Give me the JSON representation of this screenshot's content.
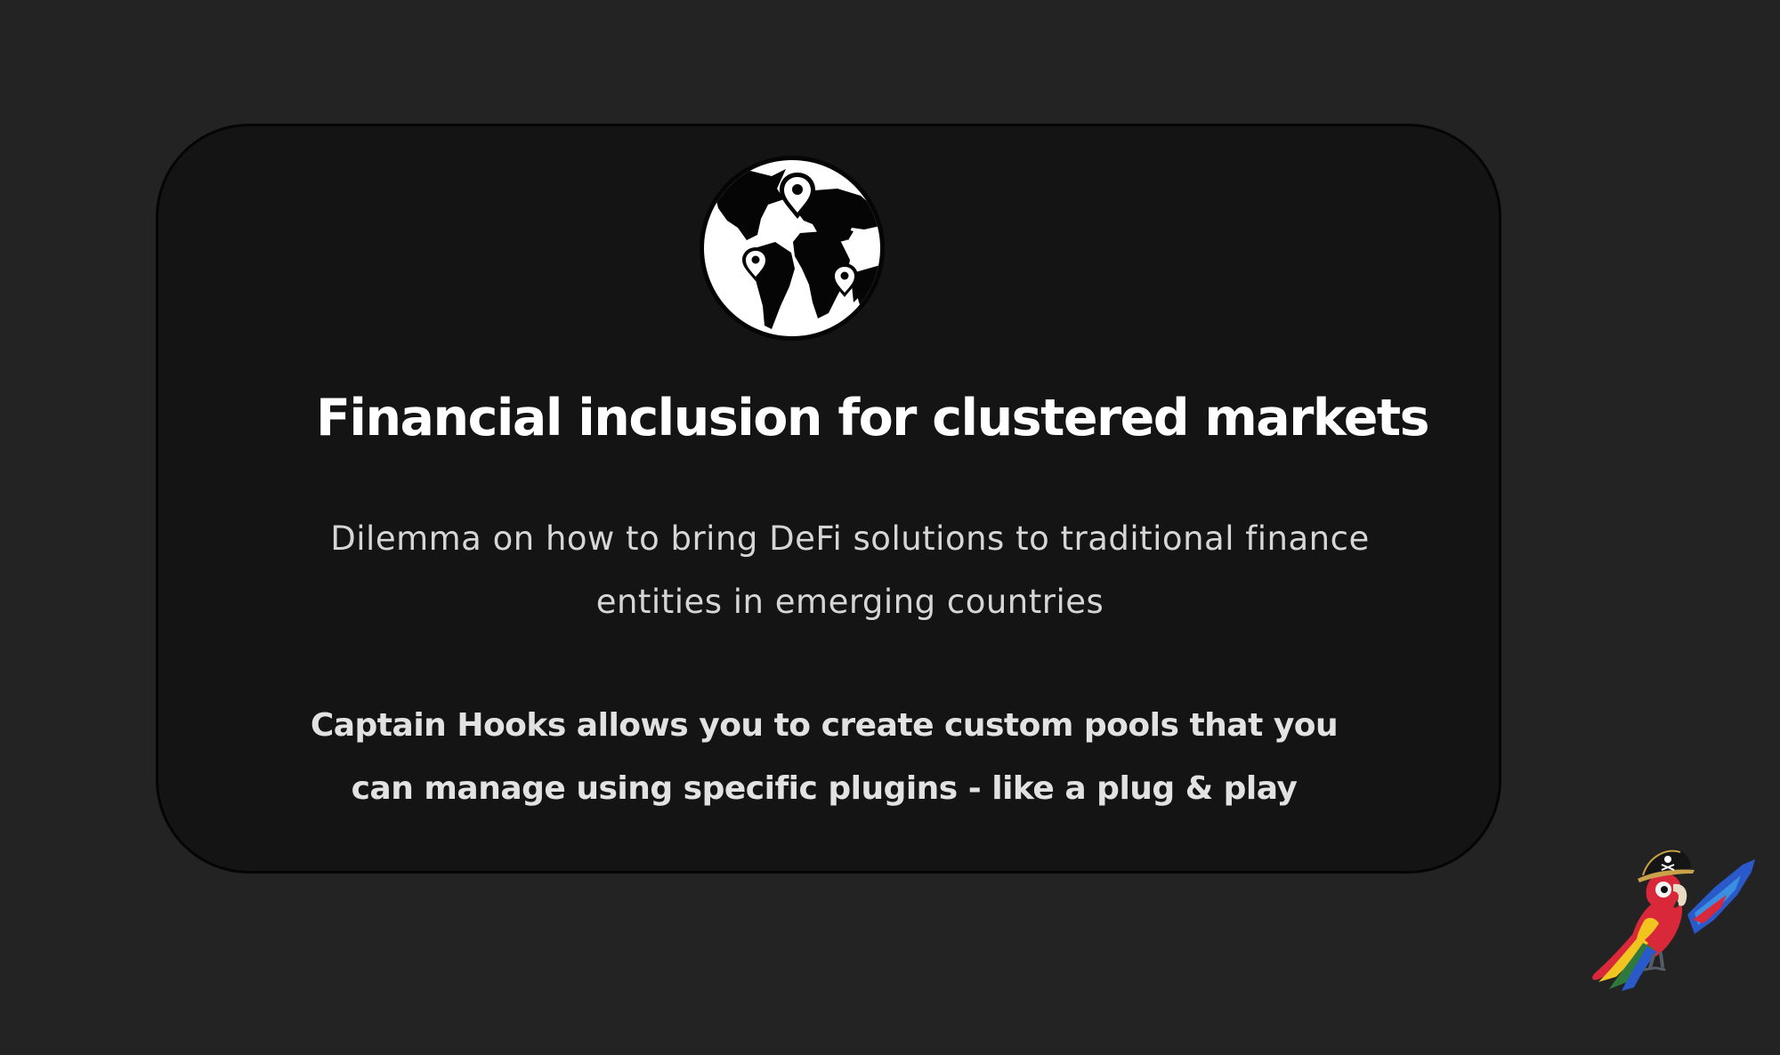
{
  "slide": {
    "globe_icon": "globe-with-location-pins-icon",
    "title": "Financial inclusion for clustered markets",
    "description": "Dilemma on how to bring DeFi solutions to traditional finance entities in emerging countries",
    "pitch": "Captain Hooks allows you to create custom pools that you can manage using specific plugins - like a plug & play",
    "mascot_icon": "pirate-parrot-mascot"
  },
  "colors": {
    "page_background": "#232323",
    "card_background": "#141414",
    "title": "#ffffff",
    "body_text": "#d6d6d6"
  }
}
